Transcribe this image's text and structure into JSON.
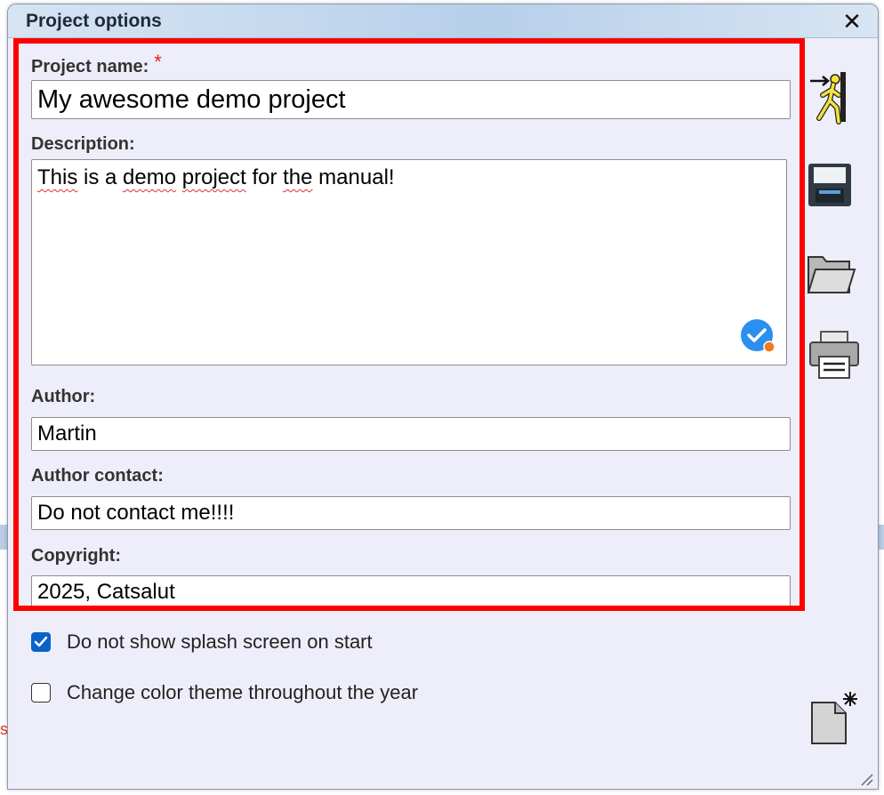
{
  "dialog": {
    "title": "Project options",
    "close_glyph": "✕"
  },
  "form": {
    "project_name": {
      "label": "Project name:",
      "required_mark": "*",
      "value": "My awesome demo project"
    },
    "description": {
      "label": "Description:",
      "value_parts": [
        "This",
        " is a ",
        "demo",
        " ",
        "project",
        " for ",
        "the",
        " manual!"
      ]
    },
    "author": {
      "label": "Author:",
      "value": "Martin"
    },
    "author_contact": {
      "label": "Author contact:",
      "value": "Do not contact me!!!!"
    },
    "copyright": {
      "label": "Copyright:",
      "value": "2025, Catsalut"
    }
  },
  "options": {
    "splash": {
      "label": "Do not show splash screen on start",
      "checked": true
    },
    "theme": {
      "label": "Change color theme throughout the year",
      "checked": false
    }
  },
  "toolbar": {
    "icons": [
      "exit-icon",
      "save-icon",
      "open-folder-icon",
      "print-icon",
      "new-document-icon"
    ]
  },
  "colors": {
    "highlight_border": "#ff0000",
    "dialog_bg": "#eeeefa",
    "checkbox_accent": "#0a63c9"
  }
}
